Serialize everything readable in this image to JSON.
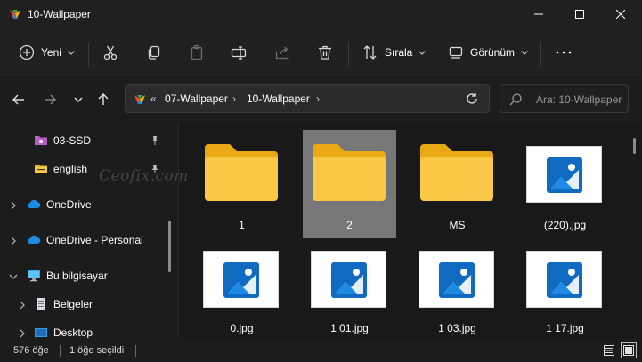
{
  "window": {
    "title": "10-Wallpaper",
    "controls": [
      "minimize-icon",
      "maximize-icon",
      "close-icon"
    ]
  },
  "toolbar": {
    "new_label": "Yeni",
    "sort_label": "Sırala",
    "view_label": "Görünüm",
    "icons": [
      "plus-circle-icon",
      "cut-icon",
      "copy-icon",
      "paste-icon",
      "rename-icon",
      "share-icon",
      "delete-icon",
      "sort-icon",
      "view-icon",
      "more-icon"
    ]
  },
  "navigation": {
    "icons": [
      "back-arrow-icon",
      "forward-arrow-icon",
      "recent-chevron-icon",
      "up-arrow-icon",
      "refresh-icon"
    ],
    "overflow_marker": "«",
    "breadcrumb": [
      "07-Wallpaper",
      "10-Wallpaper"
    ],
    "crumb_separator": "›",
    "search_placeholder": "Ara: 10-Wallpaper"
  },
  "sidebar": {
    "items": [
      {
        "label": "03-SSD",
        "icon": "purple-drive-folder-icon",
        "pinned": true,
        "has_chevron": false
      },
      {
        "label": "english",
        "icon": "folder-icon",
        "pinned": true,
        "has_chevron": false
      },
      {
        "label": "OneDrive",
        "icon": "cloud-icon",
        "pinned": false,
        "has_chevron": true,
        "expanded": false
      },
      {
        "label": "OneDrive - Personal",
        "icon": "cloud-icon",
        "pinned": false,
        "has_chevron": true,
        "expanded": false
      },
      {
        "label": "Bu bilgisayar",
        "icon": "computer-icon",
        "pinned": false,
        "has_chevron": true,
        "expanded": true
      },
      {
        "label": "Belgeler",
        "icon": "documents-icon",
        "pinned": false,
        "has_chevron": true,
        "expanded": false
      },
      {
        "label": "Desktop",
        "icon": "desktop-icon",
        "pinned": false,
        "has_chevron": true,
        "expanded": false
      }
    ]
  },
  "files": [
    {
      "name": "1",
      "type": "folder",
      "selected": false
    },
    {
      "name": "2",
      "type": "folder",
      "selected": true
    },
    {
      "name": "MS",
      "type": "folder",
      "selected": false
    },
    {
      "name": "(220).jpg",
      "type": "image",
      "selected": false
    },
    {
      "name": "0.jpg",
      "type": "image",
      "selected": false
    },
    {
      "name": "1 01.jpg",
      "type": "image",
      "selected": false
    },
    {
      "name": "1 03.jpg",
      "type": "image",
      "selected": false
    },
    {
      "name": "1 17.jpg",
      "type": "image",
      "selected": false
    }
  ],
  "watermark": "Ceofix.com",
  "status": {
    "item_count": "576 öğe",
    "selected_count": "1 öğe seçildi",
    "view_icons": [
      "details-view-icon",
      "large-icons-view-icon"
    ],
    "active_view": "large-icons-view-icon"
  },
  "colors": {
    "background": "#1c1c1c",
    "folder": "#f8c846",
    "folder_dark": "#e9a915",
    "image_accent": "#0f6ac0",
    "selection": "#777777"
  }
}
